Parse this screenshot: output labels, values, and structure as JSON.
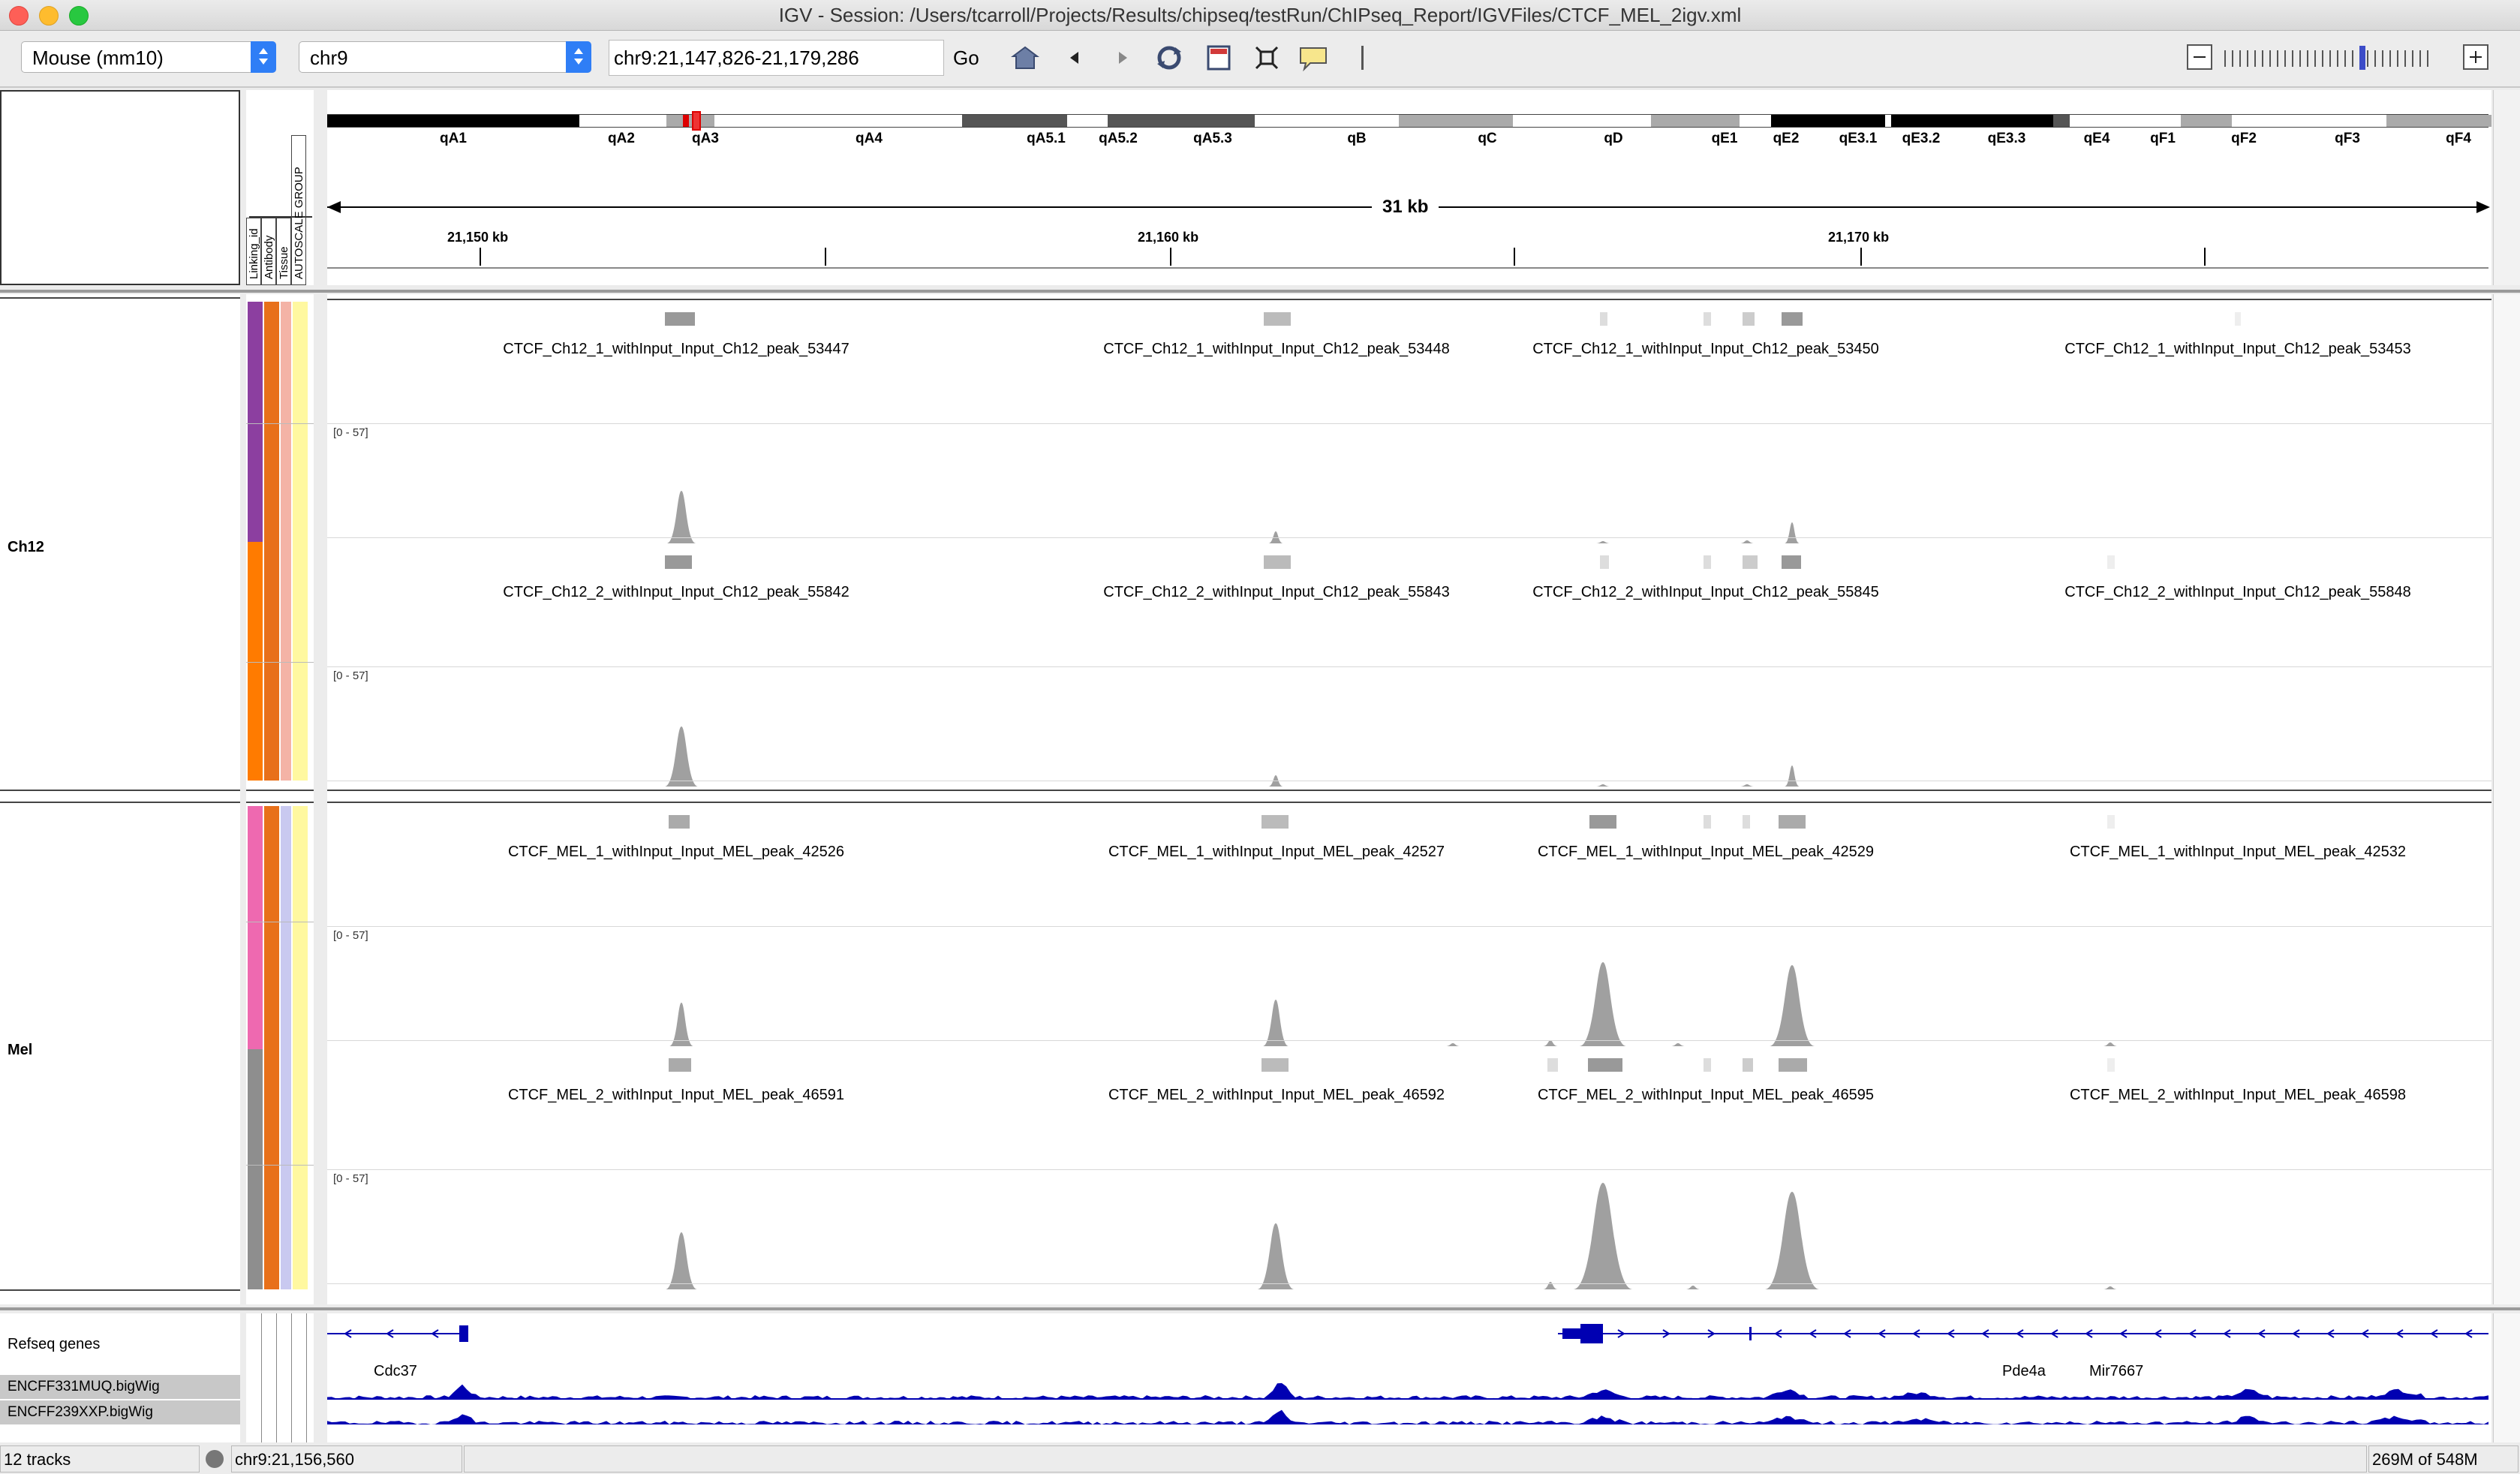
{
  "window": {
    "title": "IGV - Session: /Users/tcarroll/Projects/Results/chipseq/testRun/ChIPseq_Report/IGVFiles/CTCF_MEL_2igv.xml"
  },
  "toolbar": {
    "genome": "Mouse (mm10)",
    "chromosome": "chr9",
    "locus": "chr9:21,147,826-21,179,286",
    "go_label": "Go"
  },
  "attribute_headers": [
    "Linking_id",
    "Antibody",
    "Tissue",
    "AUTOSCALE GROUP"
  ],
  "ideogram": {
    "bands": [
      "qA1",
      "qA2",
      "qA3",
      "qA4",
      "qA5.1",
      "qA5.2",
      "qA5.3",
      "qB",
      "qC",
      "qD",
      "qE1",
      "qE2",
      "qE3.1",
      "qE3.2",
      "qE3.3",
      "qE4",
      "qF1",
      "qF2",
      "qF3",
      "qF4"
    ]
  },
  "ruler": {
    "span": "31 kb",
    "ticks": [
      "21,150 kb",
      "21,160 kb",
      "21,170 kb"
    ]
  },
  "groups": [
    {
      "name": "Ch12"
    },
    {
      "name": "Mel"
    }
  ],
  "tracks": [
    {
      "peaks": [
        "CTCF_Ch12_1_withInput_Input_Ch12_peak_53447",
        "CTCF_Ch12_1_withInput_Input_Ch12_peak_53448",
        "CTCF_Ch12_1_withInput_Input_Ch12_peak_53450",
        "CTCF_Ch12_1_withInput_Input_Ch12_peak_53453"
      ],
      "range": "[0 - 57]"
    },
    {
      "peaks": [
        "CTCF_Ch12_2_withInput_Input_Ch12_peak_55842",
        "CTCF_Ch12_2_withInput_Input_Ch12_peak_55843",
        "CTCF_Ch12_2_withInput_Input_Ch12_peak_55845",
        "CTCF_Ch12_2_withInput_Input_Ch12_peak_55848"
      ],
      "range": "[0 - 57]"
    },
    {
      "peaks": [
        "CTCF_MEL_1_withInput_Input_MEL_peak_42526",
        "CTCF_MEL_1_withInput_Input_MEL_peak_42527",
        "CTCF_MEL_1_withInput_Input_MEL_peak_42529",
        "CTCF_MEL_1_withInput_Input_MEL_peak_42532"
      ],
      "range": "[0 - 57]"
    },
    {
      "peaks": [
        "CTCF_MEL_2_withInput_Input_MEL_peak_46591",
        "CTCF_MEL_2_withInput_Input_MEL_peak_46592",
        "CTCF_MEL_2_withInput_Input_MEL_peak_46595",
        "CTCF_MEL_2_withInput_Input_MEL_peak_46598"
      ],
      "range": "[0 - 57]"
    }
  ],
  "lower_tracks": {
    "refseq_label": "Refseq genes",
    "bigwig_1": "ENCFF331MUQ.bigWig",
    "bigwig_2": "ENCFF239XXP.bigWig",
    "genes": [
      "Cdc37",
      "Pde4a",
      "Mir7667"
    ]
  },
  "status": {
    "tracks": "12 tracks",
    "position": "chr9:21,156,560",
    "memory": "269M of 548M"
  },
  "colors": {
    "gene_blue": "#0000b2",
    "signal_gray": "#a0a0a0",
    "ch12_link": "#8c3fa0",
    "mel_link_1": "#ee69b0",
    "antibody": "#e8701a",
    "autoscale": "#fff8a0"
  }
}
